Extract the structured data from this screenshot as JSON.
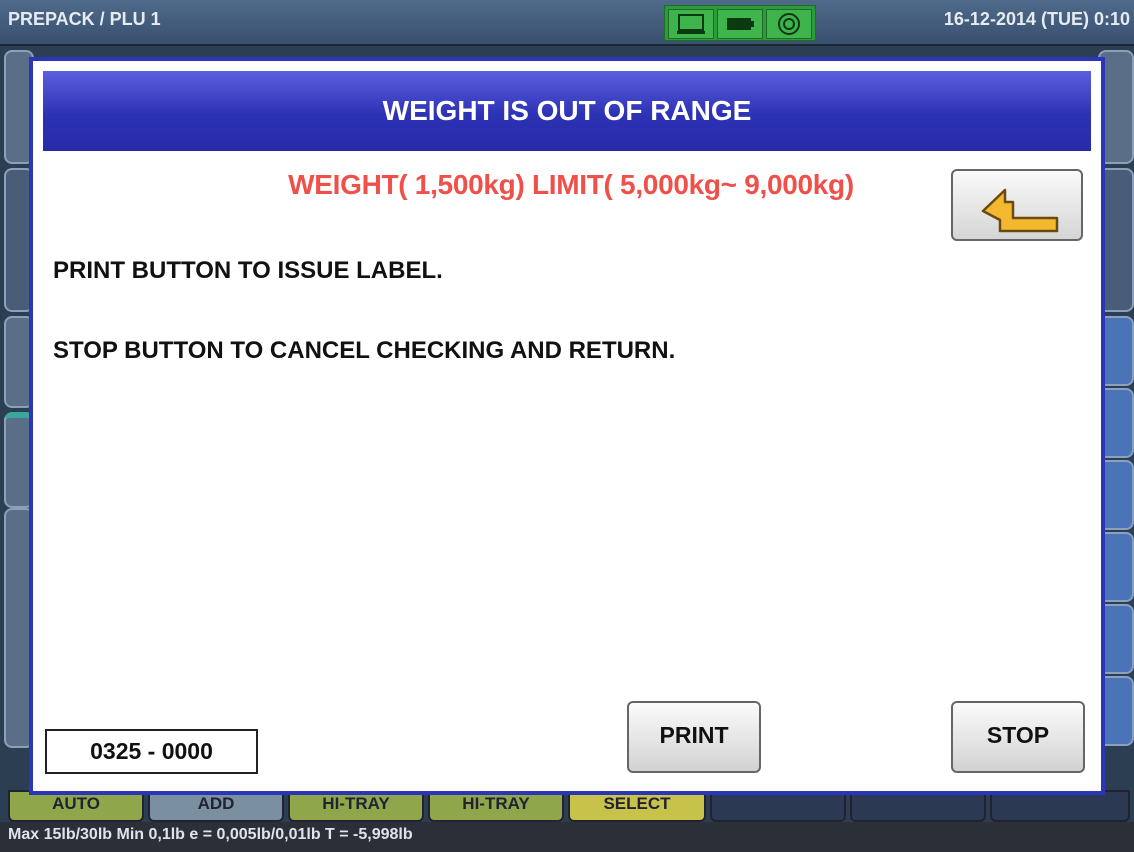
{
  "header": {
    "title": "PREPACK / PLU 1",
    "datetime": "16-12-2014 (TUE)  0:10",
    "icons": [
      "monitor-icon",
      "battery-icon",
      "network-icon"
    ]
  },
  "bottom_tabs": [
    "AUTO",
    "ADD",
    "HI-TRAY",
    "HI-TRAY",
    "SELECT",
    "",
    "",
    ""
  ],
  "footer": {
    "spec": "Max 15lb/30lb  Min 0,1lb  e = 0,005lb/0,01lb  T = -5,998lb"
  },
  "dialog": {
    "title": "WEIGHT IS OUT OF RANGE",
    "limit_text": "WEIGHT(  1,500kg) LIMIT(  5,000kg~  9,000kg)",
    "line1": "PRINT BUTTON TO ISSUE LABEL.",
    "line2": "STOP BUTTON TO CANCEL CHECKING AND RETURN.",
    "code": "0325 - 0000",
    "print_label": "PRINT",
    "stop_label": "STOP",
    "back_icon": "return-arrow-icon"
  },
  "colors": {
    "dialog_header": "#2c32b4",
    "warning_text": "#f0504a",
    "status_icon_bg": "#2f9a3c",
    "tab_auto": "#8fa64a",
    "tab_add": "#7a8fa0",
    "tab_hitray": "#8fa64a",
    "tab_select": "#c7c24a"
  }
}
